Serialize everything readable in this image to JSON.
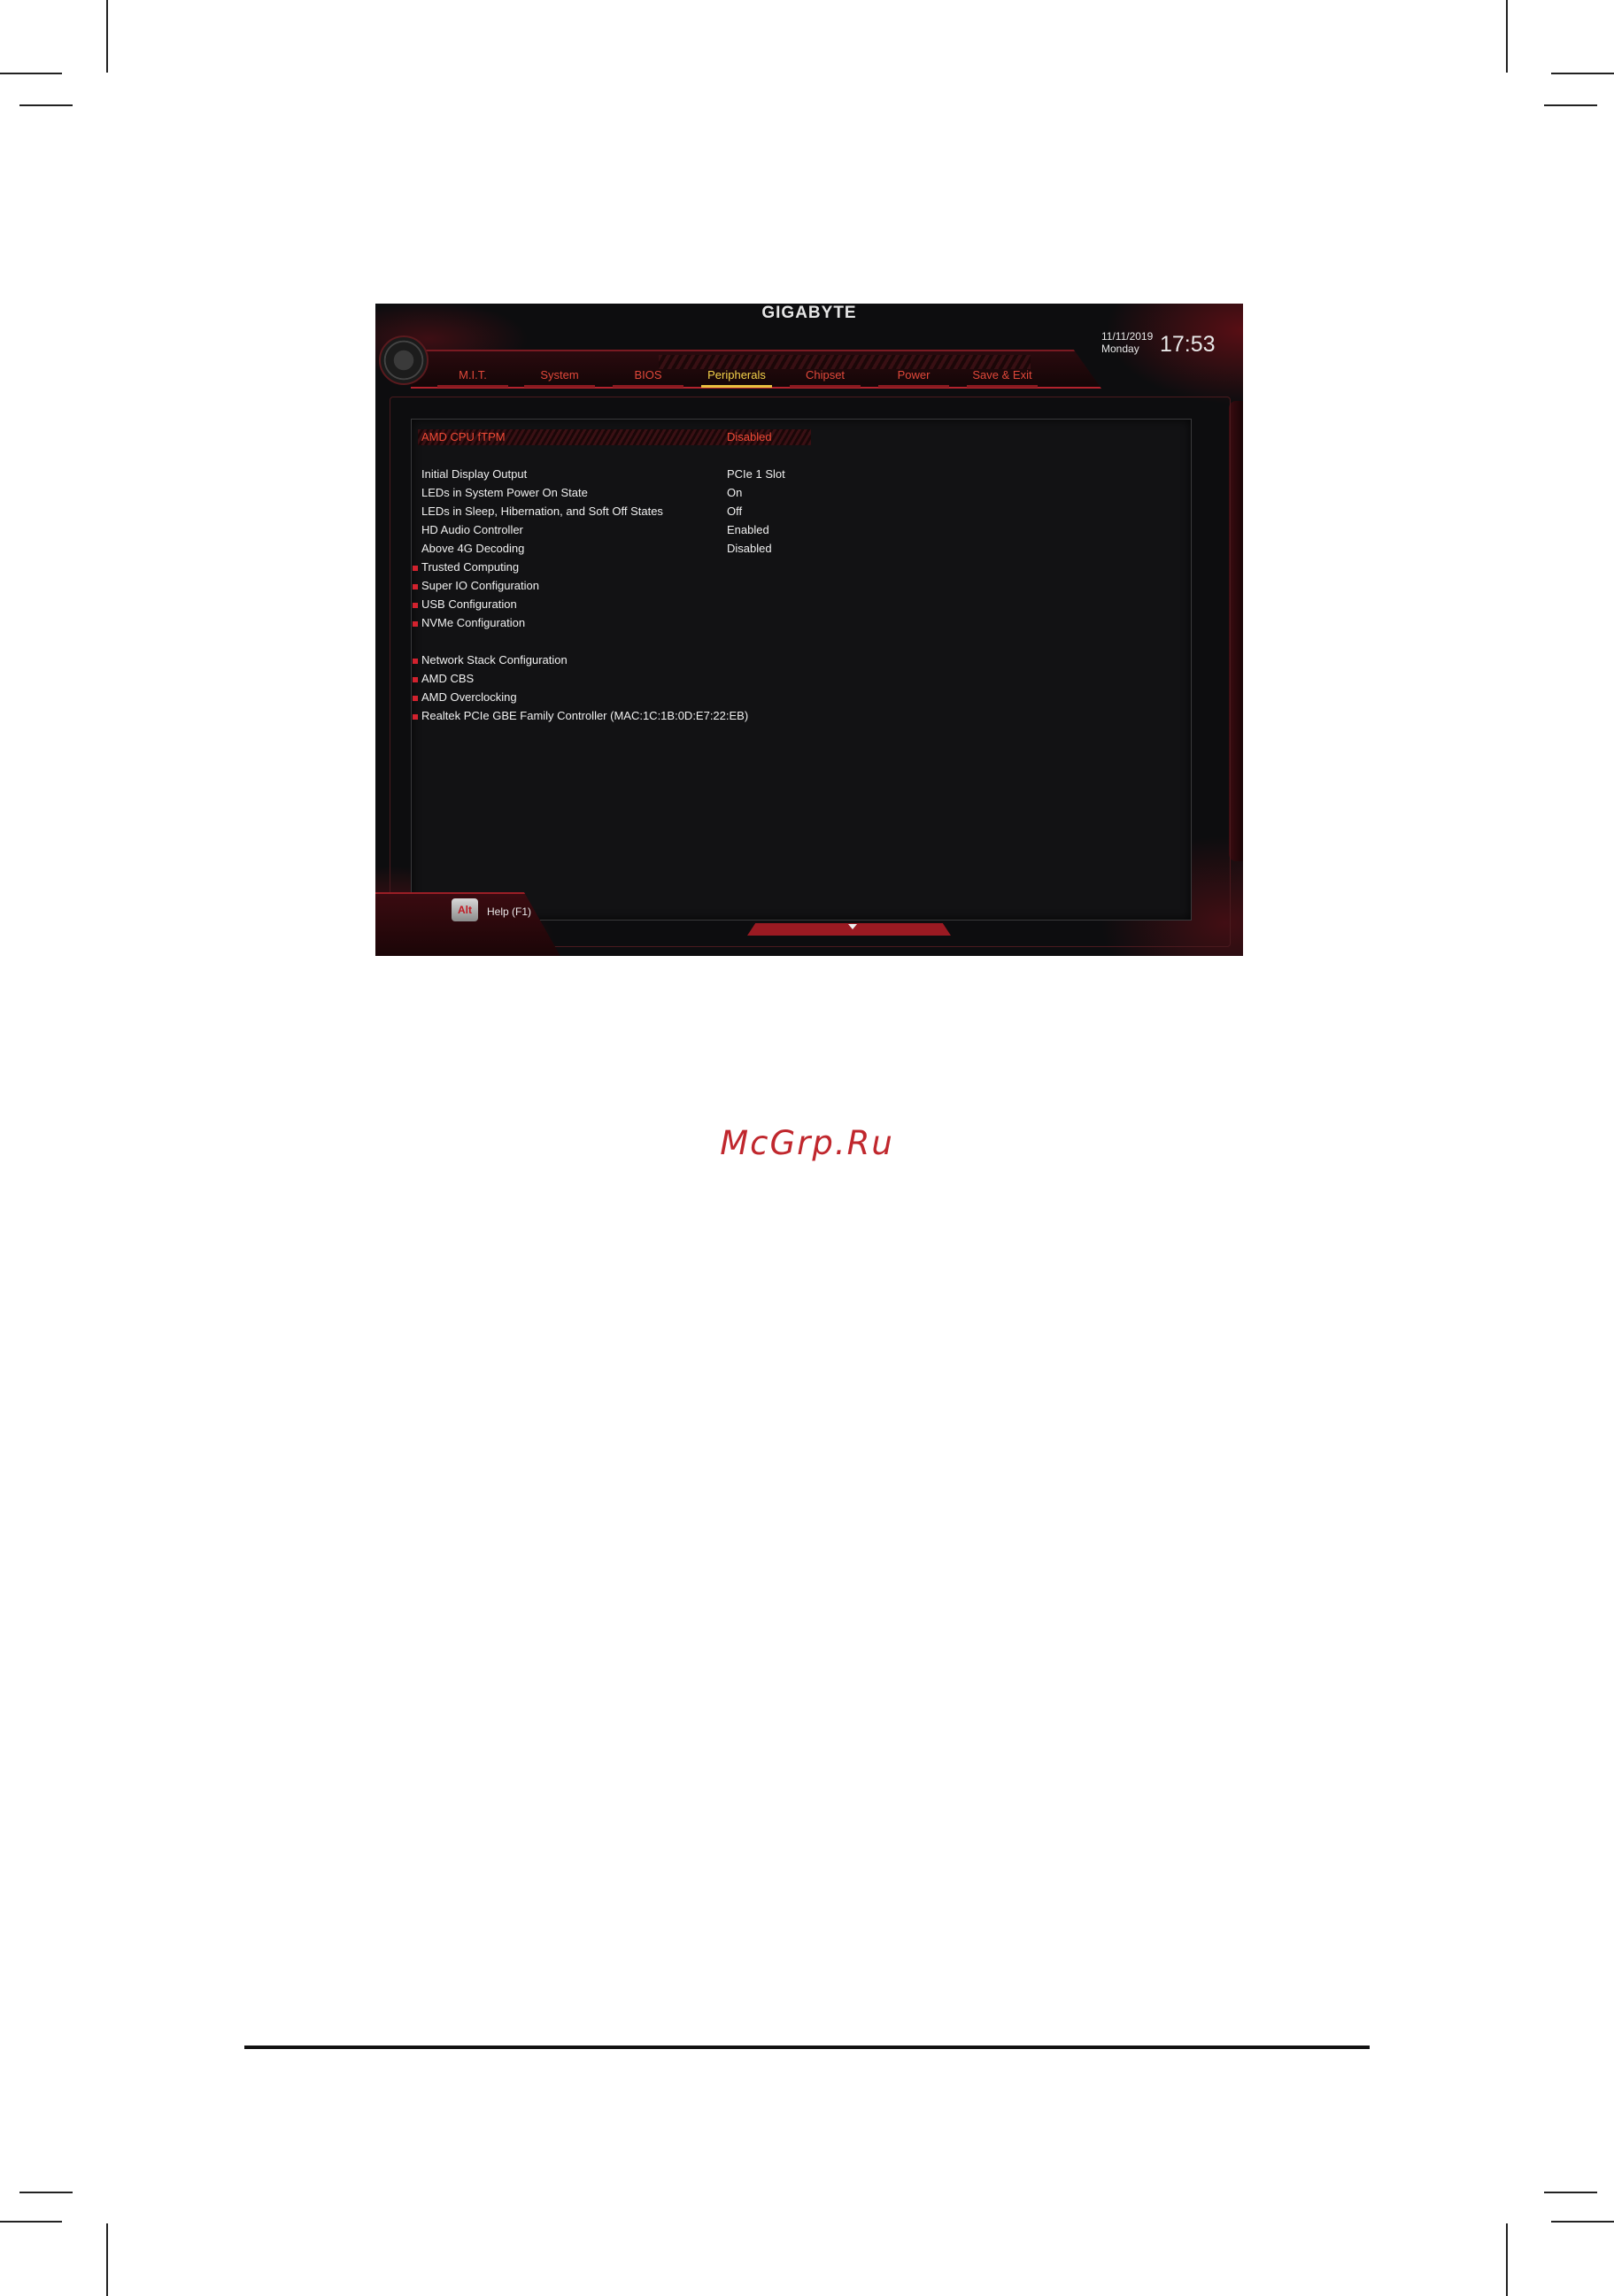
{
  "bios": {
    "brand": "GIGABYTE",
    "date": "11/11/2019",
    "day": "Monday",
    "time": "17:53",
    "tabs": [
      {
        "label": "M.I.T.",
        "active": false
      },
      {
        "label": "System",
        "active": false
      },
      {
        "label": "BIOS",
        "active": false
      },
      {
        "label": "Peripherals",
        "active": true
      },
      {
        "label": "Chipset",
        "active": false
      },
      {
        "label": "Power",
        "active": false
      },
      {
        "label": "Save & Exit",
        "active": false
      }
    ],
    "items": [
      {
        "label": "AMD CPU fTPM",
        "value": "Disabled",
        "highlighted": true
      },
      {
        "label": "Initial Display Output",
        "value": "PCIe 1 Slot"
      },
      {
        "label": "LEDs in System Power On State",
        "value": "On"
      },
      {
        "label": "LEDs in Sleep, Hibernation, and Soft Off States",
        "value": "Off"
      },
      {
        "label": "HD Audio Controller",
        "value": "Enabled"
      },
      {
        "label": "Above 4G Decoding",
        "value": "Disabled"
      },
      {
        "label": "Trusted Computing",
        "submenu": true
      },
      {
        "label": "Super IO Configuration",
        "submenu": true
      },
      {
        "label": "USB Configuration",
        "submenu": true
      },
      {
        "label": "NVMe Configuration",
        "submenu": true
      },
      {
        "label": "Network Stack Configuration",
        "submenu": true
      },
      {
        "label": "AMD CBS",
        "submenu": true
      },
      {
        "label": "AMD Overclocking",
        "submenu": true
      },
      {
        "label": "Realtek PCIe GBE Family Controller (MAC:1C:1B:0D:E7:22:EB)",
        "submenu": true
      }
    ],
    "alt_key": "Alt",
    "help": "Help (F1)"
  },
  "watermark": "McGrp.Ru",
  "colors": {
    "accent_red": "#d2222e",
    "highlight_text": "#f04a36",
    "active_tab": "#f4d24a",
    "watermark": "#c0272d"
  }
}
